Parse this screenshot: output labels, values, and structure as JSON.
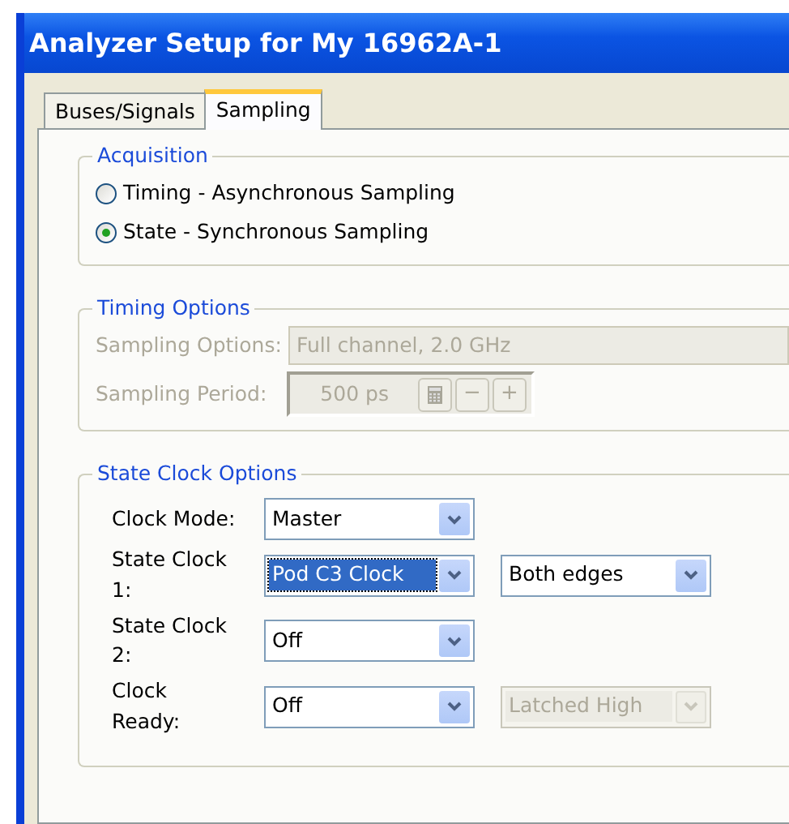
{
  "window": {
    "title": "Analyzer Setup for My 16962A-1"
  },
  "tabs": [
    {
      "label": "Buses/Signals",
      "selected": false
    },
    {
      "label": "Sampling",
      "selected": true
    }
  ],
  "acquisition": {
    "title": "Acquisition",
    "options": [
      {
        "label": "Timing - Asynchronous Sampling",
        "selected": false
      },
      {
        "label": "State - Synchronous Sampling",
        "selected": true
      }
    ]
  },
  "timing_options": {
    "title": "Timing Options",
    "disabled": true,
    "sampling_options": {
      "label": "Sampling Options:",
      "value": "Full channel, 2.0 GHz"
    },
    "sampling_period": {
      "label": "Sampling Period:",
      "value": "500 ps",
      "buttons": [
        "−",
        "+"
      ]
    }
  },
  "state_clock_options": {
    "title": "State Clock Options",
    "rows": [
      {
        "label": "Clock Mode:",
        "dropdowns": [
          {
            "value": "Master",
            "focused": false,
            "disabled": false
          }
        ]
      },
      {
        "label": "State Clock 1:",
        "dropdowns": [
          {
            "value": "Pod C3 Clock",
            "focused": true,
            "disabled": false
          },
          {
            "value": "Both edges",
            "focused": false,
            "disabled": false
          }
        ]
      },
      {
        "label": "State Clock 2:",
        "dropdowns": [
          {
            "value": "Off",
            "focused": false,
            "disabled": false
          }
        ]
      },
      {
        "label": "Clock Ready:",
        "dropdowns": [
          {
            "value": "Off",
            "focused": false,
            "disabled": false
          },
          {
            "value": "Latched High",
            "focused": false,
            "disabled": true
          }
        ]
      }
    ]
  }
}
